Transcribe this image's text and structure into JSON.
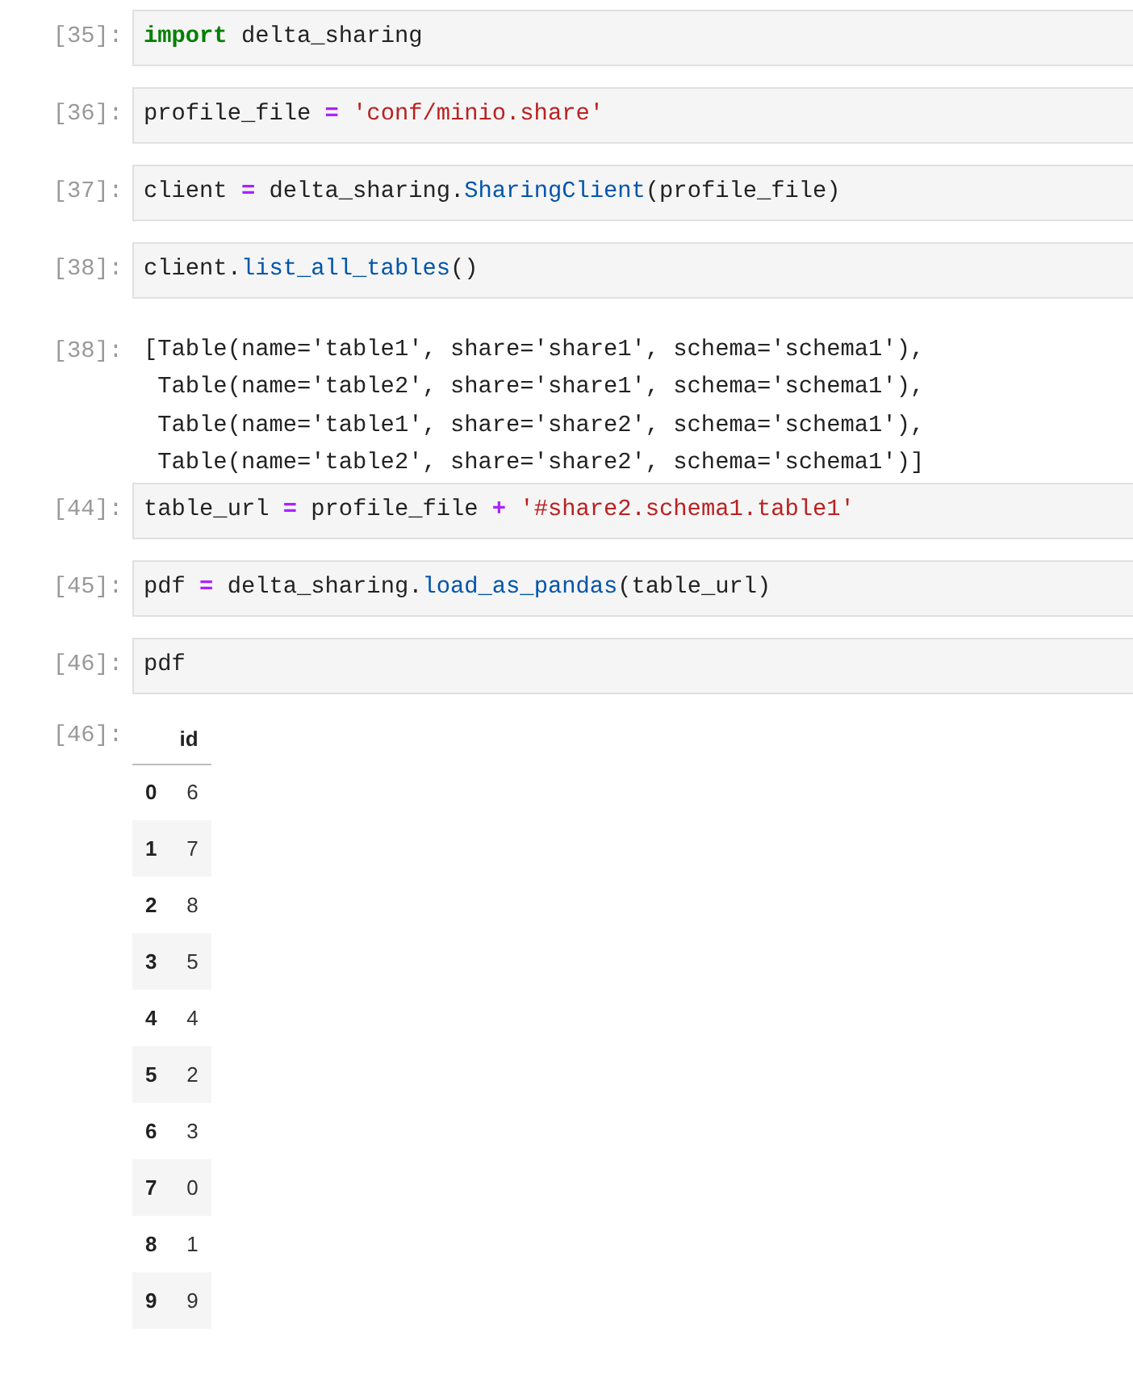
{
  "cells": [
    {
      "kind": "input",
      "prompt": "[35]:",
      "tokens": [
        {
          "kind": "keyword",
          "text": "import"
        },
        {
          "kind": "plain",
          "text": " delta_sharing"
        }
      ]
    },
    {
      "kind": "input",
      "prompt": "[36]:",
      "tokens": [
        {
          "kind": "plain",
          "text": "profile_file "
        },
        {
          "kind": "operator",
          "text": "="
        },
        {
          "kind": "string",
          "text": " 'conf/minio.share'"
        }
      ]
    },
    {
      "kind": "input",
      "prompt": "[37]:",
      "tokens": [
        {
          "kind": "plain",
          "text": "client "
        },
        {
          "kind": "operator",
          "text": "="
        },
        {
          "kind": "plain",
          "text": " delta_sharing."
        },
        {
          "kind": "function",
          "text": "SharingClient"
        },
        {
          "kind": "plain",
          "text": "(profile_file)"
        }
      ]
    },
    {
      "kind": "input",
      "prompt": "[38]:",
      "tokens": [
        {
          "kind": "plain",
          "text": "client."
        },
        {
          "kind": "function",
          "text": "list_all_tables"
        },
        {
          "kind": "plain",
          "text": "()"
        }
      ]
    },
    {
      "kind": "output_text",
      "prompt": "[38]:",
      "lines": [
        "[Table(name='table1', share='share1', schema='schema1'),",
        " Table(name='table2', share='share1', schema='schema1'),",
        " Table(name='table1', share='share2', schema='schema1'),",
        " Table(name='table2', share='share2', schema='schema1')]"
      ]
    },
    {
      "kind": "input",
      "prompt": "[44]:",
      "tokens": [
        {
          "kind": "plain",
          "text": "table_url "
        },
        {
          "kind": "operator",
          "text": "="
        },
        {
          "kind": "plain",
          "text": " profile_file "
        },
        {
          "kind": "operator",
          "text": "+"
        },
        {
          "kind": "string",
          "text": " '#share2.schema1.table1'"
        }
      ]
    },
    {
      "kind": "input",
      "prompt": "[45]:",
      "tokens": [
        {
          "kind": "plain",
          "text": "pdf "
        },
        {
          "kind": "operator",
          "text": "="
        },
        {
          "kind": "plain",
          "text": " delta_sharing."
        },
        {
          "kind": "function",
          "text": "load_as_pandas"
        },
        {
          "kind": "plain",
          "text": "(table_url)"
        }
      ]
    },
    {
      "kind": "input",
      "prompt": "[46]:",
      "tokens": [
        {
          "kind": "plain",
          "text": "pdf"
        }
      ]
    },
    {
      "kind": "output_table",
      "prompt": "[46]:",
      "columns": [
        "id"
      ],
      "rows": [
        {
          "index": "0",
          "values": [
            "6"
          ]
        },
        {
          "index": "1",
          "values": [
            "7"
          ]
        },
        {
          "index": "2",
          "values": [
            "8"
          ]
        },
        {
          "index": "3",
          "values": [
            "5"
          ]
        },
        {
          "index": "4",
          "values": [
            "4"
          ]
        },
        {
          "index": "5",
          "values": [
            "2"
          ]
        },
        {
          "index": "6",
          "values": [
            "3"
          ]
        },
        {
          "index": "7",
          "values": [
            "0"
          ]
        },
        {
          "index": "8",
          "values": [
            "1"
          ]
        },
        {
          "index": "9",
          "values": [
            "9"
          ]
        }
      ]
    }
  ]
}
